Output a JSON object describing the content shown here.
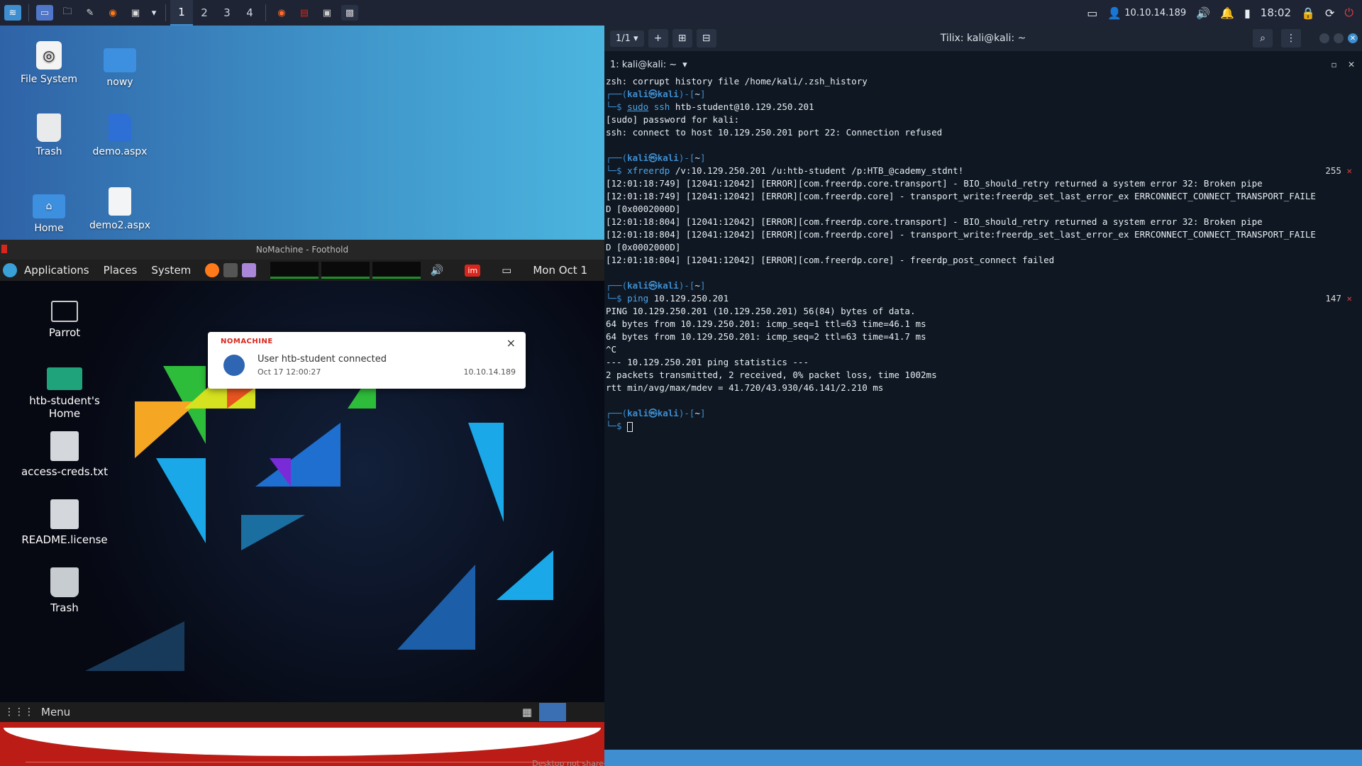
{
  "top_panel": {
    "workspaces": [
      "1",
      "2",
      "3",
      "4"
    ],
    "active_workspace": "1",
    "ip": "10.10.14.189",
    "time": "18:02"
  },
  "desktop_icons": [
    {
      "label": "File System"
    },
    {
      "label": "nowy"
    },
    {
      "label": "Trash"
    },
    {
      "label": "demo.aspx"
    },
    {
      "label": "Home"
    },
    {
      "label": "demo2.aspx"
    }
  ],
  "nomachine": {
    "title": "NoMachine - Foothold",
    "panel": {
      "applications": "Applications",
      "places": "Places",
      "system": "System",
      "date": "Mon Oct 1",
      "im_badge": "im"
    },
    "desktop_icons": [
      {
        "label": "Parrot"
      },
      {
        "label": "htb-student's Home"
      },
      {
        "label": "access-creds.txt"
      },
      {
        "label": "README.license"
      },
      {
        "label": "Trash"
      }
    ],
    "notification": {
      "brand": "NOMACHINE",
      "message": "User htb-student connected",
      "time": "Oct 17 12:00:27",
      "ip": "10.10.14.189",
      "close": "×"
    },
    "menu_label": "Menu",
    "desktop_not_shared": "Desktop not shared"
  },
  "terminal": {
    "tab_counter": "1/1",
    "title": "Tilix: kali@kali: ~",
    "session": "1: kali@kali: ~",
    "lines": [
      {
        "type": "out",
        "text": "zsh: corrupt history file /home/kali/.zsh_history"
      },
      {
        "type": "prompt1",
        "user": "kali",
        "host": "kali",
        "path": "~"
      },
      {
        "type": "cmd",
        "kw": "sudo",
        "kw2": "ssh",
        "rest": " htb-student@10.129.250.201"
      },
      {
        "type": "out",
        "text": "[sudo] password for kali:"
      },
      {
        "type": "out",
        "text": "ssh: connect to host 10.129.250.201 port 22: Connection refused"
      },
      {
        "type": "blank"
      },
      {
        "type": "prompt1",
        "user": "kali",
        "host": "kali",
        "path": "~"
      },
      {
        "type": "cmd",
        "kw": "",
        "kw2": "xfreerdp",
        "rest": " /v:10.129.250.201 /u:htb-student /p:HTB_@cademy_stdnt!",
        "status": "255"
      },
      {
        "type": "out",
        "text": "[12:01:18:749] [12041:12042] [ERROR][com.freerdp.core.transport] - BIO_should_retry returned a system error 32: Broken pipe"
      },
      {
        "type": "out",
        "text": "[12:01:18:749] [12041:12042] [ERROR][com.freerdp.core] - transport_write:freerdp_set_last_error_ex ERRCONNECT_CONNECT_TRANSPORT_FAILE"
      },
      {
        "type": "out",
        "text": "D [0x0002000D]"
      },
      {
        "type": "out",
        "text": "[12:01:18:804] [12041:12042] [ERROR][com.freerdp.core.transport] - BIO_should_retry returned a system error 32: Broken pipe"
      },
      {
        "type": "out",
        "text": "[12:01:18:804] [12041:12042] [ERROR][com.freerdp.core] - transport_write:freerdp_set_last_error_ex ERRCONNECT_CONNECT_TRANSPORT_FAILE"
      },
      {
        "type": "out",
        "text": "D [0x0002000D]"
      },
      {
        "type": "out",
        "text": "[12:01:18:804] [12041:12042] [ERROR][com.freerdp.core] - freerdp_post_connect failed"
      },
      {
        "type": "blank"
      },
      {
        "type": "prompt1",
        "user": "kali",
        "host": "kali",
        "path": "~"
      },
      {
        "type": "cmd",
        "kw": "",
        "kw2": "ping",
        "rest": " 10.129.250.201",
        "status": "147"
      },
      {
        "type": "out",
        "text": "PING 10.129.250.201 (10.129.250.201) 56(84) bytes of data."
      },
      {
        "type": "out",
        "text": "64 bytes from 10.129.250.201: icmp_seq=1 ttl=63 time=46.1 ms"
      },
      {
        "type": "out",
        "text": "64 bytes from 10.129.250.201: icmp_seq=2 ttl=63 time=41.7 ms"
      },
      {
        "type": "out",
        "text": "^C"
      },
      {
        "type": "out",
        "text": "--- 10.129.250.201 ping statistics ---"
      },
      {
        "type": "out",
        "text": "2 packets transmitted, 2 received, 0% packet loss, time 1002ms"
      },
      {
        "type": "out",
        "text": "rtt min/avg/max/mdev = 41.720/43.930/46.141/2.210 ms"
      },
      {
        "type": "blank"
      },
      {
        "type": "prompt1",
        "user": "kali",
        "host": "kali",
        "path": "~"
      },
      {
        "type": "cursor"
      }
    ]
  },
  "colors": {
    "accent": "#3e8ed0",
    "nomachine_red": "#bb1d16",
    "panel": "#1e2433",
    "terminal_bg": "#0f1722"
  }
}
